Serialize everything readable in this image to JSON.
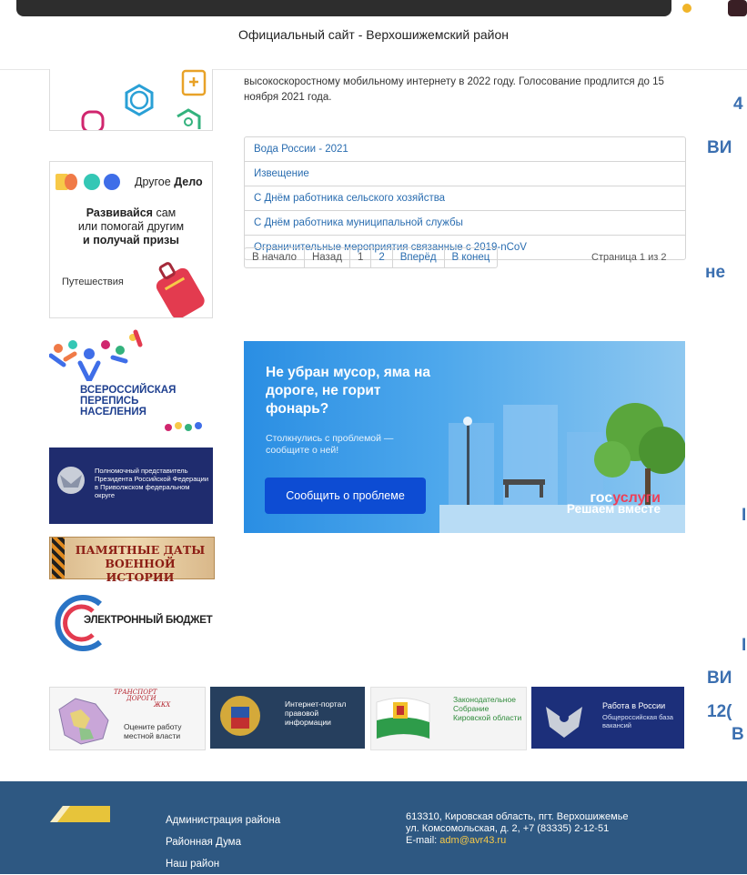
{
  "site_title": "Официальный сайт - Верхошижемский район",
  "news_text": "высокоскоростному мобильному интернету в 2022 году. Голосование продлится до 15 ноября 2021 года.",
  "news_list": [
    "Вода России - 2021",
    "Извещение",
    "С Днём работника сельского хозяйства",
    "С Днём работника муниципальной службы",
    "Ограничительные мероприятия связанные с 2019-nCoV"
  ],
  "pager": {
    "first": "В начало",
    "prev": "Назад",
    "pages": [
      "1",
      "2"
    ],
    "next": "Вперёд",
    "last": "В конец",
    "info": "Страница 1 из 2"
  },
  "sidebar": {
    "drugoe_delo": {
      "brand_a": "Другое",
      "brand_b": "Дело",
      "line1_bold": "Развивайся",
      "line1_rest": " сам",
      "line2": "или помогай другим",
      "line3": "и получай призы",
      "caption": "Путешествия"
    },
    "census": {
      "line1": "ВСЕРОССИЙСКАЯ",
      "line2": "ПЕРЕПИСЬ",
      "line3": "НАСЕЛЕНИЯ"
    },
    "envoy": "Полномочный представитель Президента Российской Федерации в Приволжском федеральном округе",
    "dates": "ПАМЯТНЫЕ ДАТЫ ВОЕННОЙ ИСТОРИИ",
    "budget": "ЭЛЕКТРОННЫЙ БЮДЖЕТ"
  },
  "promo": {
    "headline": "Не убран мусор, яма на дороге, не горит фонарь?",
    "sub": "Столкнулись с проблемой — сообщите о ней!",
    "button": "Сообщить о проблеме",
    "brand_a": "гос",
    "brand_b": "услуги",
    "slogan": "Решаем вместе"
  },
  "right_fragments": [
    "4",
    "ВИ",
    "не",
    "I",
    "I",
    "ВИ",
    "12(",
    "В"
  ],
  "bottom_banners": {
    "transport_line1": "ТРАНСПОРТ",
    "transport_line2": "ДОРОГИ",
    "transport_line3": "ЖКХ",
    "transport_caption1": "Оцените работу",
    "transport_caption2": "местной власти",
    "portal": "Интернет-портал правовой информации",
    "assembly": "Законодательное Собрание Кировской области",
    "jobs_title": "Работа в России",
    "jobs_sub": "Общероссийская база вакансий"
  },
  "footer": {
    "links": [
      "Администрация района",
      "Районная Дума",
      "Наш район"
    ],
    "address1": "613310, Кировская область, пгт. Верхошижемье",
    "address2": "ул. Комсомольская, д. 2, +7 (83335) 2-12-51",
    "email_label": "E-mail:",
    "email": "adm@avr43.ru"
  },
  "colors": {
    "link": "#2a6db0",
    "footer_bg": "#2e5882",
    "promo_button": "#0d4cd3",
    "accent_text": "#3b6fb0"
  }
}
